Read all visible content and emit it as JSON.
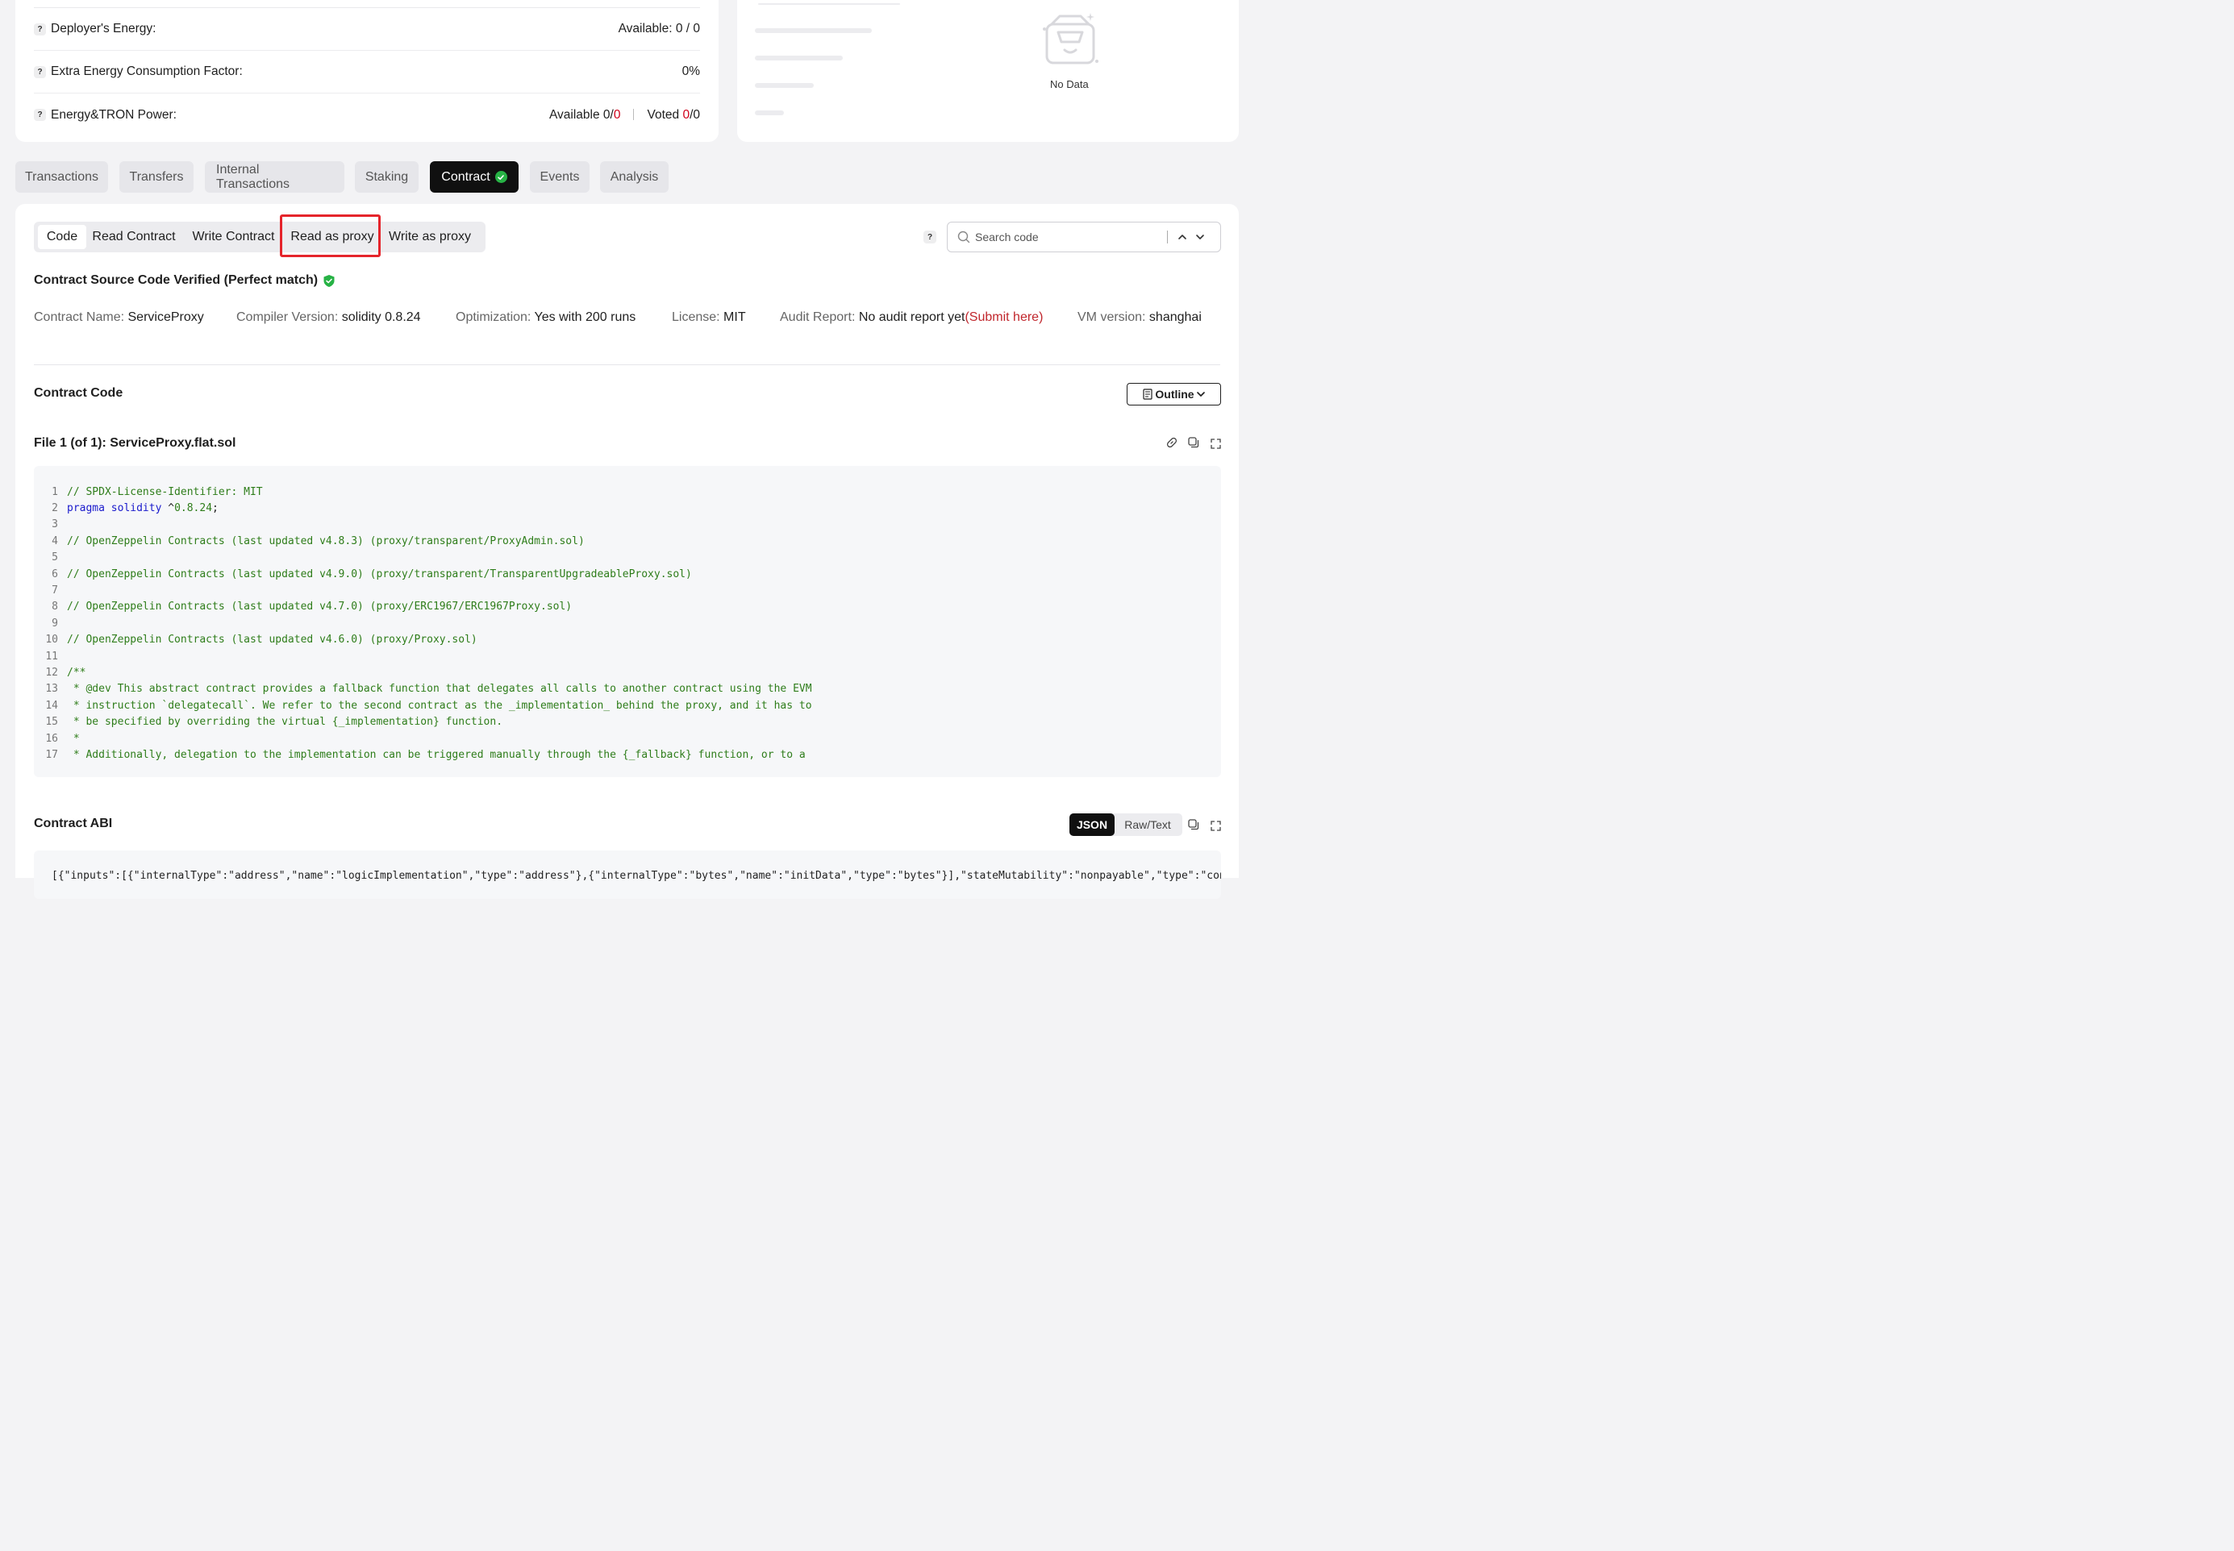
{
  "energy": {
    "rows": [
      {
        "label": "Deployer's Energy:",
        "value": "Available: 0 / 0"
      },
      {
        "label": "Extra Energy Consumption Factor:",
        "value": "0%"
      },
      {
        "label": "Energy&TRON Power:",
        "available_label": "Available 0/",
        "available_red": "0",
        "voted_label": "Voted ",
        "voted_red": "0",
        "voted_suffix": "/0"
      }
    ],
    "help_glyph": "?"
  },
  "nodata": {
    "text": "No Data",
    "icon": "empty-box-icon"
  },
  "tabs": [
    {
      "label": "Transactions"
    },
    {
      "label": "Transfers"
    },
    {
      "label": "Internal Transactions"
    },
    {
      "label": "Staking"
    },
    {
      "label": "Contract",
      "active": true
    },
    {
      "label": "Events"
    },
    {
      "label": "Analysis"
    }
  ],
  "subtabs": [
    {
      "label": "Code",
      "active": true
    },
    {
      "label": "Read Contract"
    },
    {
      "label": "Write Contract"
    },
    {
      "label": "Read as proxy",
      "highlighted": true
    },
    {
      "label": "Write as proxy"
    }
  ],
  "search": {
    "placeholder": "Search code",
    "help_glyph": "?"
  },
  "verification": {
    "title": "Contract Source Code Verified (Perfect match)"
  },
  "contract_info": {
    "name_key": "Contract Name:",
    "name_val": "ServiceProxy",
    "compiler_key": "Compiler Version:",
    "compiler_val": "solidity 0.8.24",
    "opt_key": "Optimization:",
    "opt_val": "Yes with 200 runs",
    "license_key": "License:",
    "license_val": "MIT",
    "audit_key": "Audit Report:",
    "audit_val": "No audit report yet",
    "audit_link": "(Submit here)",
    "vm_key": "VM version:",
    "vm_val": "shanghai"
  },
  "contract_code": {
    "title": "Contract Code",
    "outline_label": "Outline",
    "file_title": "File 1 (of 1): ServiceProxy.flat.sol",
    "lines": [
      {
        "n": "1",
        "parts": [
          {
            "c": "ct",
            "t": "// SPDX-License-Identifier: MIT"
          }
        ]
      },
      {
        "n": "2",
        "parts": [
          {
            "c": "kw",
            "t": "pragma solidity"
          },
          {
            "c": "pl",
            "t": " ^"
          },
          {
            "c": "nm",
            "t": "0.8.24"
          },
          {
            "c": "pl",
            "t": ";"
          }
        ]
      },
      {
        "n": "3",
        "parts": []
      },
      {
        "n": "4",
        "parts": [
          {
            "c": "ct",
            "t": "// OpenZeppelin Contracts (last updated v4.8.3) (proxy/transparent/ProxyAdmin.sol)"
          }
        ]
      },
      {
        "n": "5",
        "parts": []
      },
      {
        "n": "6",
        "parts": [
          {
            "c": "ct",
            "t": "// OpenZeppelin Contracts (last updated v4.9.0) (proxy/transparent/TransparentUpgradeableProxy.sol)"
          }
        ]
      },
      {
        "n": "7",
        "parts": []
      },
      {
        "n": "8",
        "parts": [
          {
            "c": "ct",
            "t": "// OpenZeppelin Contracts (last updated v4.7.0) (proxy/ERC1967/ERC1967Proxy.sol)"
          }
        ]
      },
      {
        "n": "9",
        "parts": []
      },
      {
        "n": "10",
        "parts": [
          {
            "c": "ct",
            "t": "// OpenZeppelin Contracts (last updated v4.6.0) (proxy/Proxy.sol)"
          }
        ]
      },
      {
        "n": "11",
        "parts": []
      },
      {
        "n": "12",
        "parts": [
          {
            "c": "ct",
            "t": "/**"
          }
        ]
      },
      {
        "n": "13",
        "parts": [
          {
            "c": "ct",
            "t": " * @dev This abstract contract provides a fallback function that delegates all calls to another contract using the EVM"
          }
        ]
      },
      {
        "n": "14",
        "parts": [
          {
            "c": "ct",
            "t": " * instruction `delegatecall`. We refer to the second contract as the _implementation_ behind the proxy, and it has to"
          }
        ]
      },
      {
        "n": "15",
        "parts": [
          {
            "c": "ct",
            "t": " * be specified by overriding the virtual {_implementation} function."
          }
        ]
      },
      {
        "n": "16",
        "parts": [
          {
            "c": "ct",
            "t": " *"
          }
        ]
      },
      {
        "n": "17",
        "parts": [
          {
            "c": "ct",
            "t": " * Additionally, delegation to the implementation can be triggered manually through the {_fallback} function, or to a"
          }
        ]
      }
    ]
  },
  "abi": {
    "title": "Contract ABI",
    "json_label": "JSON",
    "raw_label": "Raw/Text",
    "text": "[{\"inputs\":[{\"internalType\":\"address\",\"name\":\"logicImplementation\",\"type\":\"address\"},{\"internalType\":\"bytes\",\"name\":\"initData\",\"type\":\"bytes\"}],\"stateMutability\":\"nonpayable\",\"type\":\"constructor\"},{"
  },
  "colors": {
    "accent_red": "#d0021b",
    "verified_green": "#27b245",
    "highlight_border": "#e5242b"
  }
}
